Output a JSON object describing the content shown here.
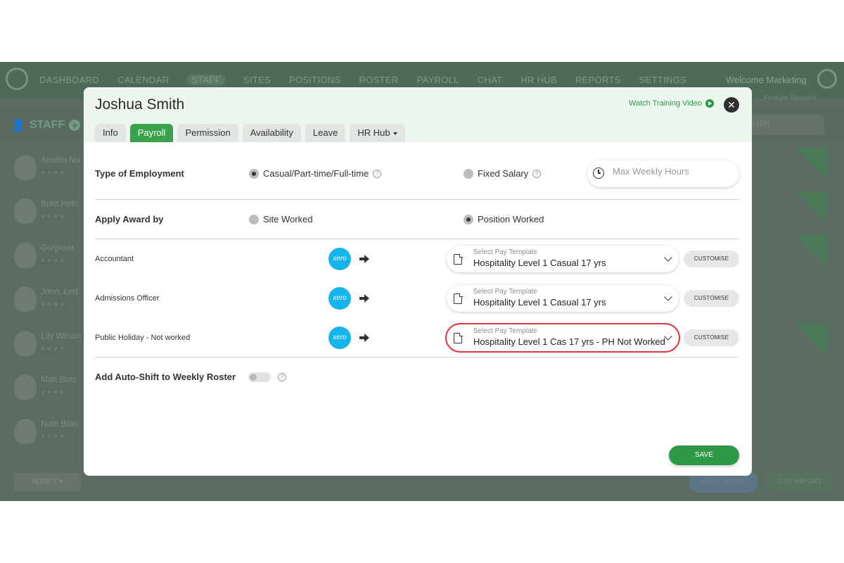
{
  "background_app": {
    "nav": [
      "DASHBOARD",
      "CALENDAR",
      "STAFF",
      "SITES",
      "POSITIONS",
      "ROSTER",
      "PAYROLL",
      "CHAT",
      "HR HUB",
      "REPORTS",
      "SETTINGS"
    ],
    "welcome": "Welcome Marketing",
    "feature_request": "Feature Request",
    "staff_title": "STAFF",
    "count_text": "n (33)",
    "staff_list": [
      "Amelia No",
      "Brett Holn",
      "Gurpreet",
      "John. Led",
      "Lily Wilson",
      "Matt Butc",
      "Nate Blan"
    ],
    "notify": "NOTIFY ▾",
    "xero_import": "XERO IMPORT",
    "csv_import": "CSV IMPORT"
  },
  "modal": {
    "title": "Joshua Smith",
    "training_video": "Watch Training Video",
    "close": "✕",
    "tabs": [
      "Info",
      "Payroll",
      "Permission",
      "Availability",
      "Leave",
      "HR Hub"
    ],
    "employment": {
      "label": "Type of Employment",
      "option_casual": "Casual/Part-time/Full-time",
      "option_fixed": "Fixed Salary",
      "max_hours_placeholder": "Max Weekly Hours"
    },
    "award": {
      "label": "Apply Award by",
      "option_site": "Site Worked",
      "option_position": "Position Worked"
    },
    "rows": [
      {
        "position": "Accountant",
        "xero": "xero",
        "placeholder": "Select Pay Template",
        "value": "Hospitality Level 1 Casual 17 yrs",
        "customise": "CUSTOMISE"
      },
      {
        "position": "Admissions Officer",
        "xero": "xero",
        "placeholder": "Select Pay Template",
        "value": "Hospitality Level 1 Casual 17 yrs",
        "customise": "CUSTOMISE"
      },
      {
        "position": "Public Holiday - Not worked",
        "xero": "xero",
        "placeholder": "Select Pay Template",
        "value": "Hospitality Level 1 Cas 17 yrs - PH Not Worked",
        "customise": "CUSTOMISE"
      }
    ],
    "auto_shift": {
      "label": "Add Auto-Shift to Weekly Roster"
    },
    "save": "SAVE"
  },
  "colors": {
    "accent": "#3aa24b",
    "xero": "#13b5ea",
    "highlight": "#e2323a",
    "overlay": "#5d6c63"
  }
}
